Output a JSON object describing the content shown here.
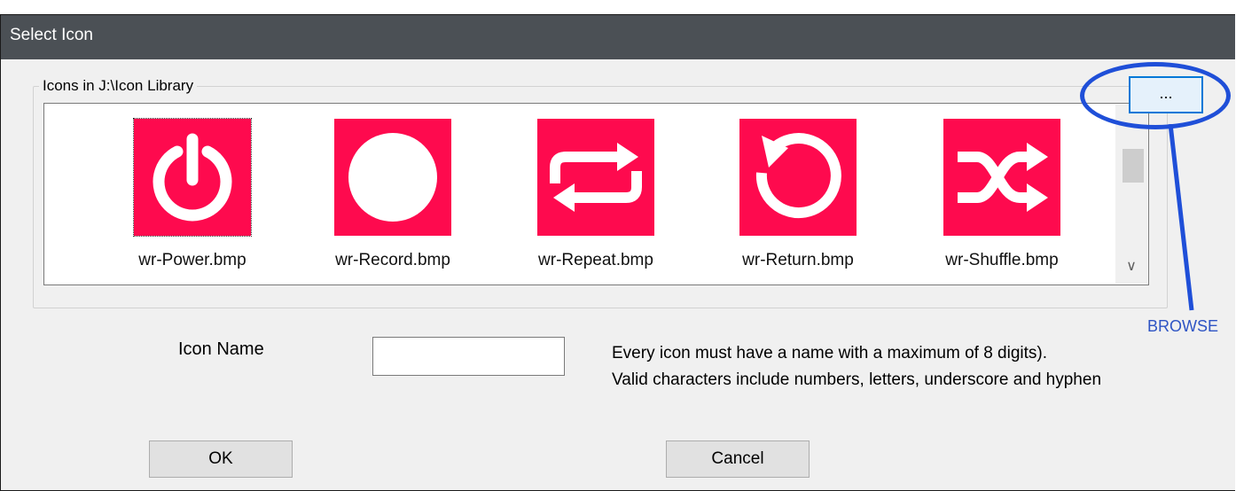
{
  "dialog": {
    "title": "Select Icon",
    "group_label": "Icons in J:\\Icon Library",
    "browse_button": "...",
    "browse_annotation": "BROWSE"
  },
  "icons": [
    {
      "caption": "wr-Power.bmp",
      "icon": "power-icon"
    },
    {
      "caption": "wr-Record.bmp",
      "icon": "record-icon"
    },
    {
      "caption": "wr-Repeat.bmp",
      "icon": "repeat-icon"
    },
    {
      "caption": "wr-Return.bmp",
      "icon": "return-icon"
    },
    {
      "caption": "wr-Shuffle.bmp",
      "icon": "shuffle-icon"
    }
  ],
  "form": {
    "icon_name_label": "Icon Name",
    "icon_name_value": "",
    "help_line1": "Every icon must have a name with a maximum of 8 digits).",
    "help_line2": "Valid characters include numbers, letters, underscore and hyphen"
  },
  "buttons": {
    "ok": "OK",
    "cancel": "Cancel"
  },
  "colors": {
    "icon_tile": "#fe0a4e",
    "titlebar": "#4b5055",
    "annotation": "#1f4fd8"
  }
}
